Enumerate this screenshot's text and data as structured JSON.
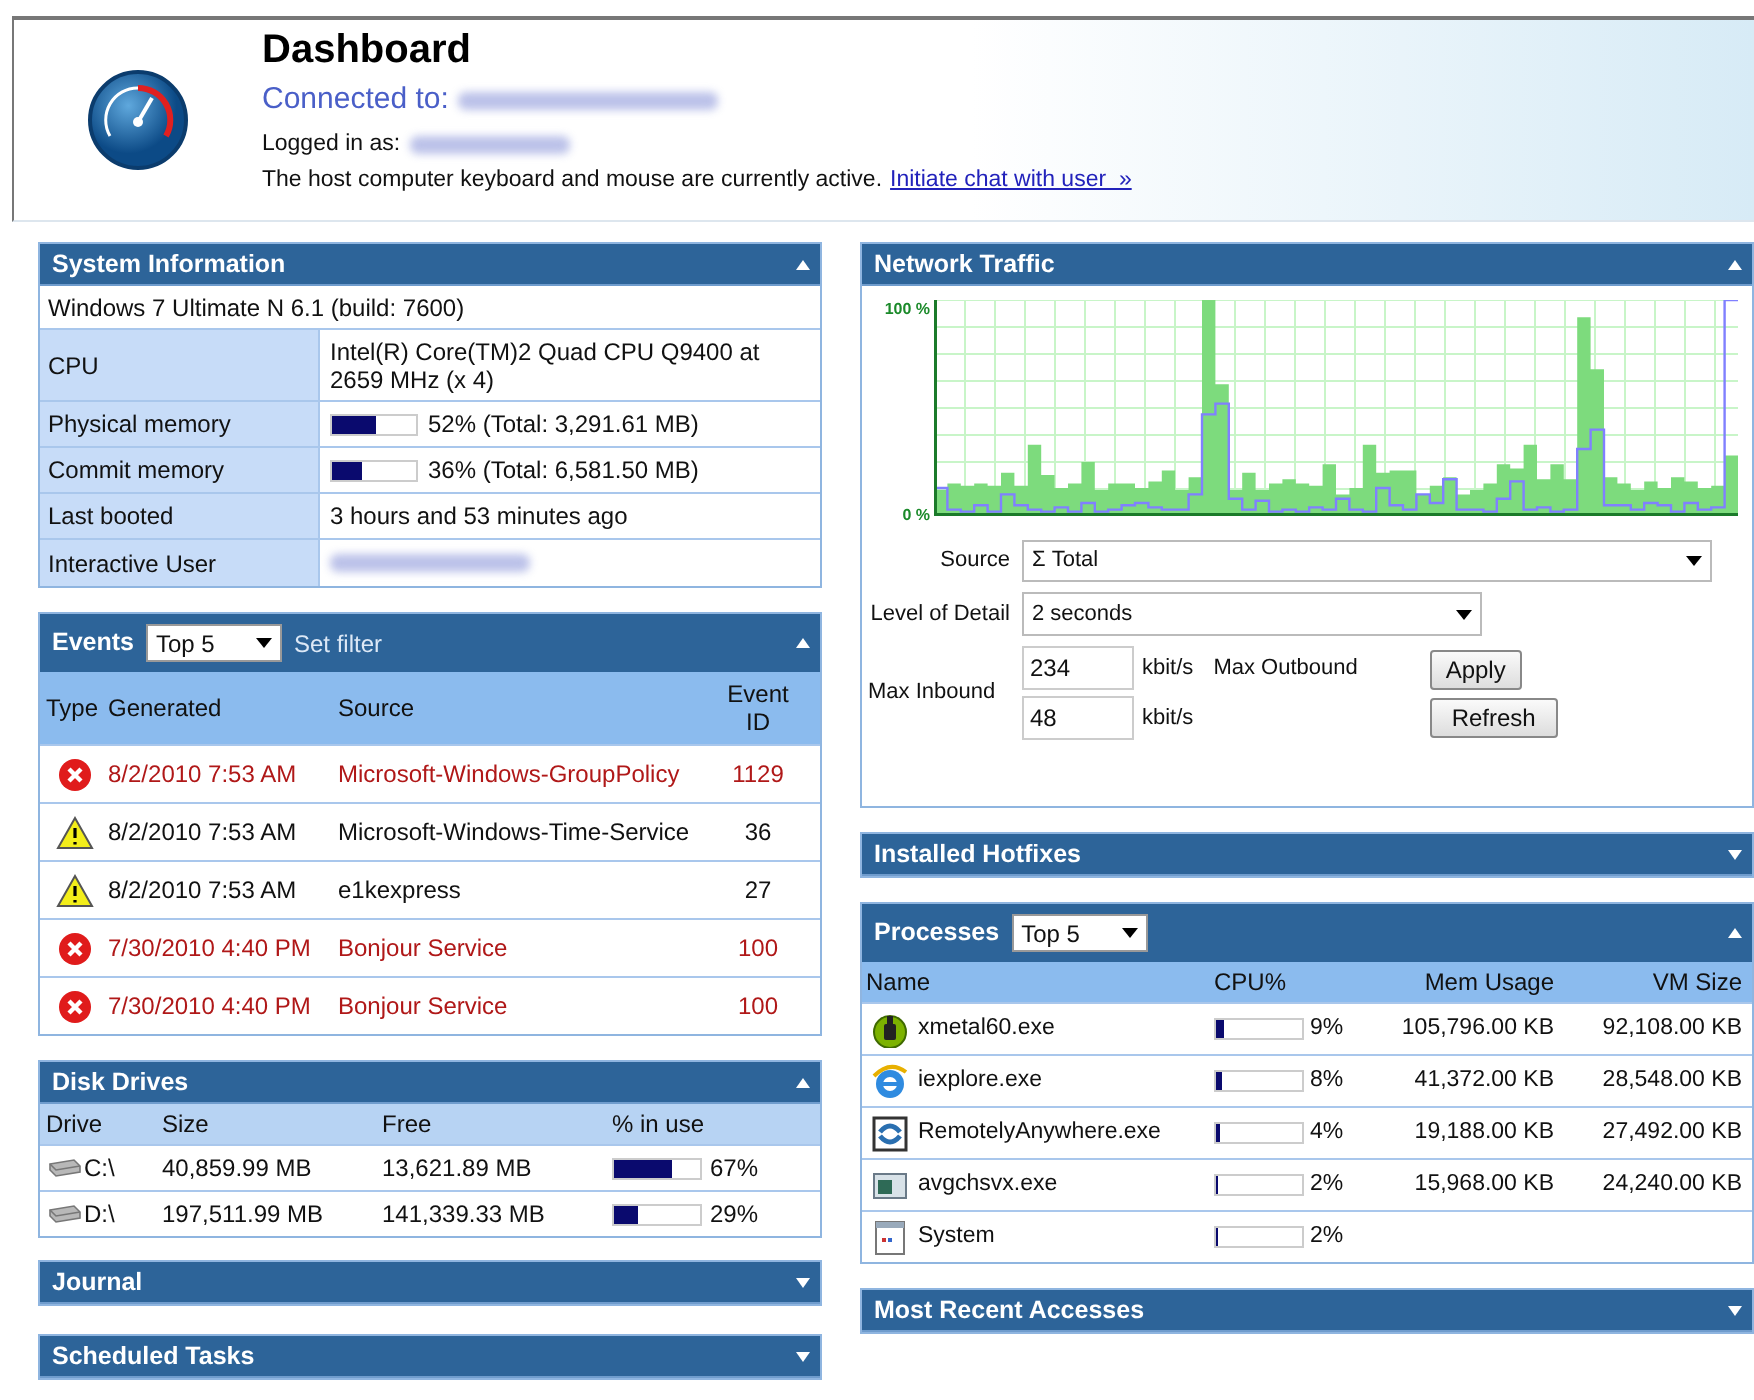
{
  "header": {
    "title": "Dashboard",
    "connected_label": "Connected to:",
    "logged_in_label": "Logged in as:",
    "message": "The host computer keyboard and mouse are currently active.",
    "chat_link": "Initiate chat with user  »"
  },
  "system_information": {
    "title": "System Information",
    "expanded": true,
    "rows": [
      {
        "kind": "text",
        "value": "Windows 7 Ultimate N 6.1 (build: 7600)"
      },
      {
        "kind": "pair",
        "label": "CPU",
        "value": "Intel(R) Core(TM)2 Quad CPU Q9400 at 2659 MHz (x 4)"
      },
      {
        "kind": "meter",
        "label": "Physical memory",
        "level": 0.52,
        "value": "52% (Total: 3,291.61 MB)"
      },
      {
        "kind": "meter",
        "label": "Commit memory",
        "level": 0.36,
        "value": "36% (Total: 6,581.50 MB)"
      },
      {
        "kind": "pair",
        "label": "Last booted",
        "value": "3 hours and 53 minutes ago"
      },
      {
        "kind": "redacted",
        "label": "Interactive User"
      }
    ]
  },
  "events": {
    "title": "Events",
    "filter": "Top 5",
    "set_filter": "Set filter",
    "expanded": true,
    "columns": [
      "Type",
      "Generated",
      "Source",
      "Event ID"
    ],
    "rows": [
      {
        "kind": "error",
        "generated": "8/2/2010 7:53 AM",
        "source": "Microsoft-Windows-GroupPolicy",
        "event_id": "1129"
      },
      {
        "kind": "warning",
        "generated": "8/2/2010 7:53 AM",
        "source": "Microsoft-Windows-Time-Service",
        "event_id": "36"
      },
      {
        "kind": "warning",
        "generated": "8/2/2010 7:53 AM",
        "source": "e1kexpress",
        "event_id": "27"
      },
      {
        "kind": "error",
        "generated": "7/30/2010 4:40 PM",
        "source": "Bonjour Service",
        "event_id": "100"
      },
      {
        "kind": "error",
        "generated": "7/30/2010 4:40 PM",
        "source": "Bonjour Service",
        "event_id": "100"
      }
    ]
  },
  "disk_drives": {
    "title": "Disk Drives",
    "expanded": true,
    "columns": [
      "Drive",
      "Size",
      "Free",
      "% in use"
    ],
    "rows": [
      {
        "drive": "C:\\",
        "size": "40,859.99 MB",
        "free": "13,621.89 MB",
        "level": 0.67,
        "percent": "67%"
      },
      {
        "drive": "D:\\",
        "size": "197,511.99 MB",
        "free": "141,339.33 MB",
        "level": 0.29,
        "percent": "29%"
      }
    ]
  },
  "journal": {
    "title": "Journal",
    "expanded": false
  },
  "scheduled_tasks": {
    "title": "Scheduled Tasks",
    "expanded": false
  },
  "network_traffic": {
    "title": "Network Traffic",
    "expanded": true,
    "graph_labels": [
      "100 %",
      "0 %"
    ],
    "source_label": "Source",
    "source": "Σ Total",
    "detail_label": "Level of Detail",
    "detail": "2 seconds",
    "max_inbound_label": "Max Inbound",
    "max_inbound": "234",
    "max_outbound_label": "Max Outbound",
    "max_outbound": "48",
    "unit_inbound": "kbit/s",
    "unit_outbound": "kbit/s",
    "apply": "Apply",
    "refresh": "Refresh"
  },
  "installed_hotfixes": {
    "title": "Installed Hotfixes",
    "expanded": false
  },
  "processes": {
    "title": "Processes",
    "filter": "Top 5",
    "expanded": true,
    "columns": [
      "Name",
      "CPU%",
      "Mem Usage",
      "VM Size"
    ],
    "rows": [
      {
        "name": "xmetal60.exe",
        "level": 0.09,
        "cpu": "9%",
        "mem": "105,796.00 KB",
        "vm": "92,108.00 KB"
      },
      {
        "name": "iexplore.exe",
        "level": 0.08,
        "cpu": "8%",
        "mem": "41,372.00 KB",
        "vm": "28,548.00 KB"
      },
      {
        "name": "RemotelyAnywhere.exe",
        "level": 0.04,
        "cpu": "4%",
        "mem": "19,188.00 KB",
        "vm": "27,492.00 KB"
      },
      {
        "name": "avgchsvx.exe",
        "level": 0.02,
        "cpu": "2%",
        "mem": "15,968.00 KB",
        "vm": "24,240.00 KB"
      },
      {
        "name": "System",
        "level": 0.02,
        "cpu": "2%"
      }
    ]
  },
  "most_recent_accesses": {
    "title": "Most Recent Accesses",
    "expanded": false
  }
}
